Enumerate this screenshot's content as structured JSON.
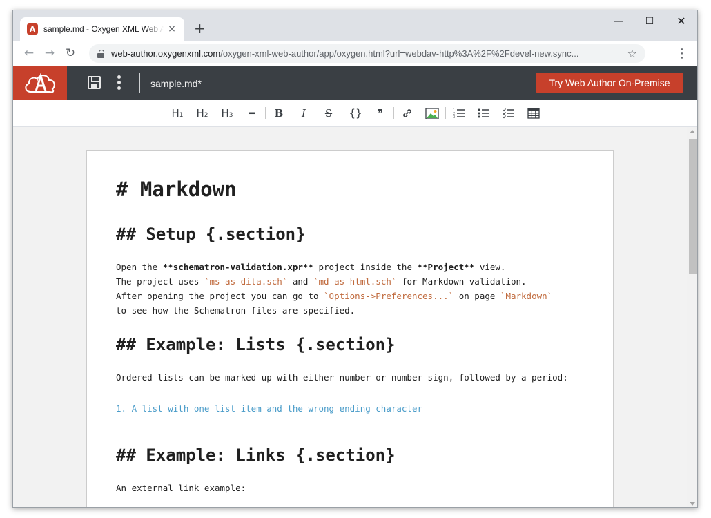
{
  "browser": {
    "tab_title": "sample.md - Oxygen XML Web Author",
    "tab_close": "×",
    "new_tab": "+",
    "url_host": "web-author.oxygenxml.com",
    "url_path": "/oxygen-xml-web-author/app/oxygen.html?url=webdav-http%3A%2F%2Fdevel-new.sync...",
    "win_min": "—",
    "win_max": "☐",
    "win_close": "✕",
    "back": "←",
    "forward": "→",
    "reload": "↻",
    "star": "☆",
    "menu": "⋮"
  },
  "app": {
    "favicon_letter": "A",
    "document_name": "sample.md*",
    "cta_label": "Try Web Author On-Premise"
  },
  "format_toolbar": {
    "h1": "H",
    "h1_num": "1",
    "h2": "H",
    "h2_num": "2",
    "h3": "H",
    "h3_num": "3",
    "hr": "━",
    "bold": "B",
    "italic": "I",
    "strike": "S",
    "code": "{}",
    "quote": "❞",
    "link": "🔗",
    "ordered_list": "≔",
    "unordered_list": "☰",
    "task_list": "☑",
    "table": "▦"
  },
  "document": {
    "h1": "# Markdown",
    "setup_heading": "## Setup {.section}",
    "setup_p1_a": "Open the ",
    "setup_p1_b": "**schematron-validation.xpr**",
    "setup_p1_c": " project inside the ",
    "setup_p1_d": "**Project**",
    "setup_p1_e": " view.",
    "setup_p2_a": "The project uses ",
    "setup_p2_b": "`ms-as-dita.sch`",
    "setup_p2_c": " and ",
    "setup_p2_d": "`md-as-html.sch`",
    "setup_p2_e": " for Markdown validation.",
    "setup_p3_a": "After opening the project you can go to ",
    "setup_p3_b": "`Options->Preferences...`",
    "setup_p3_c": " on page ",
    "setup_p3_d": "`Markdown`",
    "setup_p4": "to see how the Schematron files are specified.",
    "lists_heading": "## Example: Lists {.section}",
    "lists_p1": "Ordered lists can be marked up with either number or number sign, followed by a period:",
    "lists_item": "1. A list with one list item and the wrong ending character",
    "links_heading": "## Example: Links {.section}",
    "links_p1": "An external link example:"
  }
}
